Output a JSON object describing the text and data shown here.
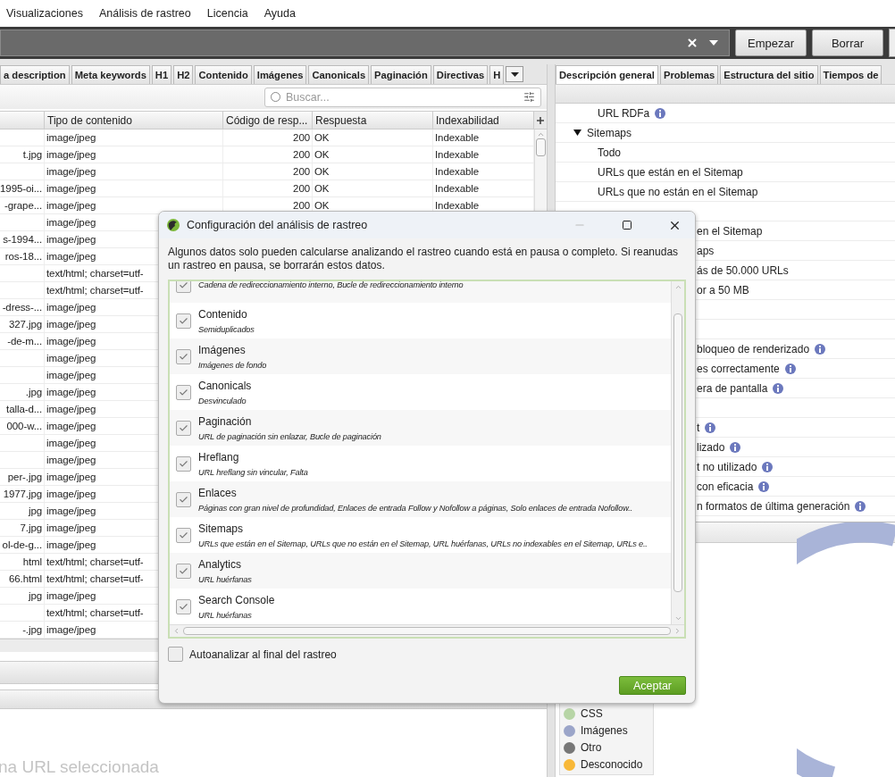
{
  "menu": [
    "Visualizaciones",
    "Análisis de rastreo",
    "Licencia",
    "Ayuda"
  ],
  "toolbar": {
    "buttons": [
      "Empezar",
      "Borrar"
    ]
  },
  "left_tabs": [
    {
      "label": "a description",
      "selected": false
    },
    {
      "label": "Meta keywords",
      "selected": false
    },
    {
      "label": "H1",
      "selected": false
    },
    {
      "label": "H2",
      "selected": false
    },
    {
      "label": "Contenido",
      "selected": false
    },
    {
      "label": "Imágenes",
      "selected": false
    },
    {
      "label": "Canonicals",
      "selected": false
    },
    {
      "label": "Paginación",
      "selected": false
    },
    {
      "label": "Directivas",
      "selected": false
    },
    {
      "label": "H",
      "selected": false
    }
  ],
  "search": {
    "placeholder": "Buscar..."
  },
  "table": {
    "columns": [
      "Tipo de contenido",
      "Código de resp...",
      "Respuesta",
      "Indexabilidad"
    ],
    "rows": [
      {
        "type": "image/jpeg",
        "code": "200",
        "response": "OK",
        "index": "Indexable"
      },
      {
        "url": "t.jpg",
        "type": "image/jpeg",
        "code": "200",
        "response": "OK",
        "index": "Indexable"
      },
      {
        "type": "image/jpeg",
        "code": "200",
        "response": "OK",
        "index": "Indexable"
      },
      {
        "url": "1995-oi...",
        "type": "image/jpeg",
        "code": "200",
        "response": "OK",
        "index": "Indexable"
      },
      {
        "url": "-grape...",
        "type": "image/jpeg",
        "code": "200",
        "response": "OK",
        "index": "Indexable"
      },
      {
        "type": "image/jpeg"
      },
      {
        "url": "s-1994...",
        "type": "image/jpeg"
      },
      {
        "url": "ros-18...",
        "type": "image/jpeg"
      },
      {
        "type": "text/html; charset=utf-"
      },
      {
        "type": "text/html; charset=utf-"
      },
      {
        "url": "-dress-...",
        "type": "image/jpeg"
      },
      {
        "url": "327.jpg",
        "type": "image/jpeg"
      },
      {
        "url": "-de-m...",
        "type": "image/jpeg"
      },
      {
        "type": "image/jpeg"
      },
      {
        "type": "image/jpeg"
      },
      {
        "url": ".jpg",
        "type": "image/jpeg"
      },
      {
        "url": "talla-d...",
        "type": "image/jpeg"
      },
      {
        "url": "000-w...",
        "type": "image/jpeg"
      },
      {
        "type": "image/jpeg"
      },
      {
        "type": "image/jpeg"
      },
      {
        "url": "per-.jpg",
        "type": "image/jpeg"
      },
      {
        "url": "1977.jpg",
        "type": "image/jpeg"
      },
      {
        "url": "jpg",
        "type": "image/jpeg"
      },
      {
        "url": "7.jpg",
        "type": "image/jpeg"
      },
      {
        "url": "ol-de-g...",
        "type": "image/jpeg"
      },
      {
        "url": "html",
        "type": "text/html; charset=utf-"
      },
      {
        "url": "66.html",
        "type": "text/html; charset=utf-"
      },
      {
        "url": "jpg",
        "type": "image/jpeg"
      },
      {
        "type": "text/html; charset=utf-"
      },
      {
        "url": "-.jpg",
        "type": "image/jpeg"
      }
    ]
  },
  "bottom_left_text": "na URL seleccionada",
  "right_tabs": [
    {
      "label": "Descripción general",
      "selected": true
    },
    {
      "label": "Problemas",
      "selected": false
    },
    {
      "label": "Estructura del sitio",
      "selected": false
    },
    {
      "label": "Tiempos de",
      "selected": false
    }
  ],
  "tree": [
    {
      "kind": "item",
      "label": "URL RDFa",
      "info": true
    },
    {
      "kind": "group",
      "label": "Sitemaps",
      "expanded": true,
      "children": [
        {
          "label": "Todo",
          "info": false
        },
        {
          "label": "URLs que están en el Sitemap",
          "info": false
        },
        {
          "label": "URLs que no están en el Sitemap",
          "info": false
        }
      ]
    },
    {
      "kind": "blank"
    },
    {
      "kind": "partial",
      "label": "en el Sitemap",
      "info": false
    },
    {
      "kind": "partial",
      "label": "aps",
      "info": false
    },
    {
      "kind": "partial",
      "label": "ás de 50.000 URLs",
      "info": false
    },
    {
      "kind": "partial",
      "label": "or a 50 MB",
      "info": false
    },
    {
      "kind": "blank"
    },
    {
      "kind": "blank"
    },
    {
      "kind": "partial",
      "label": "bloqueo de renderizado",
      "info": true
    },
    {
      "kind": "partial",
      "label": "es correctamente",
      "info": true
    },
    {
      "kind": "partial",
      "label": "era de pantalla",
      "info": true
    },
    {
      "kind": "blank"
    },
    {
      "kind": "partial",
      "label": "t",
      "info": true
    },
    {
      "kind": "partial",
      "label": "lizado",
      "info": true
    },
    {
      "kind": "partial",
      "label": "t no utilizado",
      "info": true
    },
    {
      "kind": "partial",
      "label": "con eficacia",
      "info": true
    },
    {
      "kind": "partial",
      "label": "n formatos de última generación",
      "info": true
    }
  ],
  "legend": [
    {
      "label": "CSS",
      "color": "#b7d5a6"
    },
    {
      "label": "Imágenes",
      "color": "#9ba5c9"
    },
    {
      "label": "Otro",
      "color": "#777777"
    },
    {
      "label": "Desconocido",
      "color": "#f8b838"
    }
  ],
  "dialog": {
    "title": "Configuración del análisis de rastreo",
    "description": "Algunos datos solo pueden calcularse analizando el rastreo cuando está en pausa o completo. Si reanudas un rastreo en pausa, se borrarán estos datos.",
    "items": [
      {
        "detail": "Cadena de redireccionamiento interno, Bucle de redireccionamiento interno",
        "checked": true
      },
      {
        "label": "Contenido",
        "detail": "Semiduplicados",
        "checked": true
      },
      {
        "label": "Imágenes",
        "detail": "Imágenes de fondo",
        "checked": true
      },
      {
        "label": "Canonicals",
        "detail": "Desvinculado",
        "checked": true
      },
      {
        "label": "Paginación",
        "detail": "URL de paginación sin enlazar, Bucle de paginación",
        "checked": true
      },
      {
        "label": "Hreflang",
        "detail": "URL hreflang sin vincular, Falta",
        "checked": true
      },
      {
        "label": "Enlaces",
        "detail": "Páginas con gran nivel de profundidad, Enlaces de entrada Follow y Nofollow a páginas, Solo enlaces de entrada Nofollow..",
        "checked": true
      },
      {
        "label": "Sitemaps",
        "detail": "URLs que están en el Sitemap, URLs que no están en el Sitemap, URL huérfanas, URLs no indexables en el Sitemap, URLs e..",
        "checked": true
      },
      {
        "label": "Analytics",
        "detail": "URL huérfanas",
        "checked": true
      },
      {
        "label": "Search Console",
        "detail": "URL huérfanas",
        "checked": true
      }
    ],
    "auto_analyze": {
      "label": "Autoanalizar al final del rastreo",
      "checked": false
    },
    "accept": "Aceptar"
  }
}
